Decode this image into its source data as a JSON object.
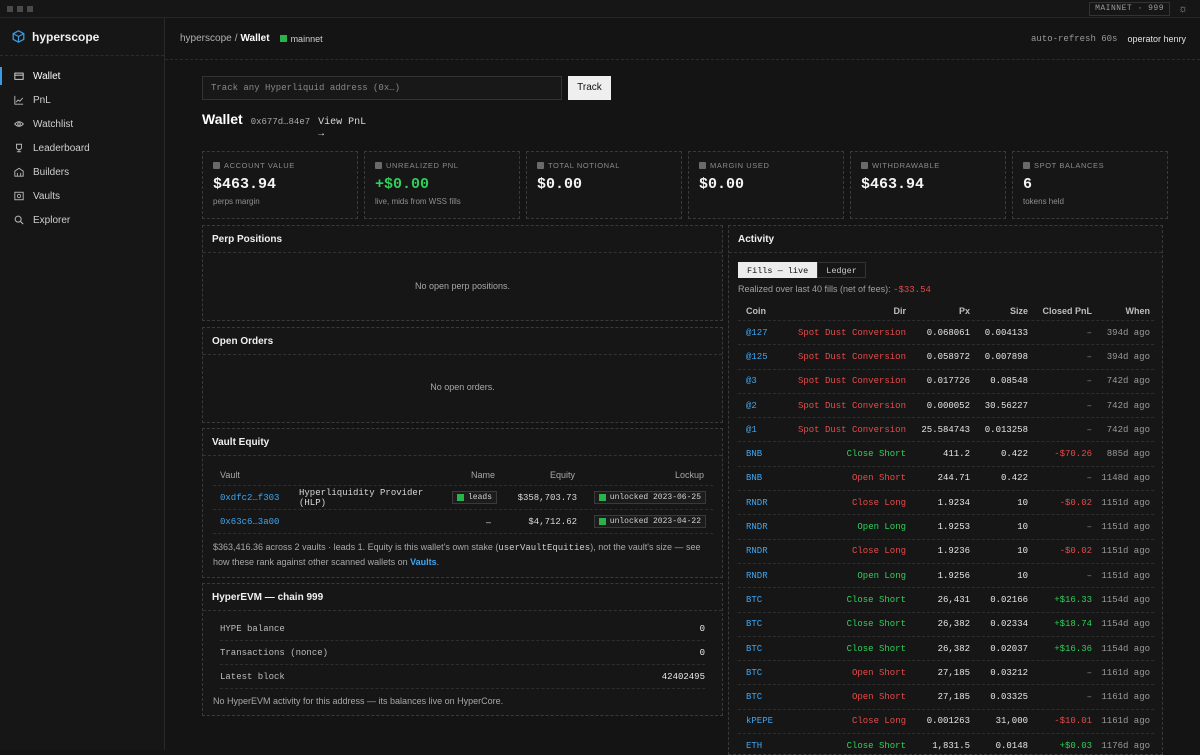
{
  "topbar": {
    "network_badge": "MAINNET · 999",
    "theme_icon": "sun-icon"
  },
  "sidebar": {
    "brand": "hyperscope",
    "items": [
      {
        "label": "Wallet",
        "icon": "wallet-icon",
        "active": true
      },
      {
        "label": "PnL",
        "icon": "chart-icon"
      },
      {
        "label": "Watchlist",
        "icon": "eye-icon"
      },
      {
        "label": "Leaderboard",
        "icon": "trophy-icon"
      },
      {
        "label": "Builders",
        "icon": "building-icon"
      },
      {
        "label": "Vaults",
        "icon": "vault-icon"
      },
      {
        "label": "Explorer",
        "icon": "search-icon"
      }
    ]
  },
  "header": {
    "crumb_root": "hyperscope",
    "crumb_sep": "/",
    "crumb_current": "Wallet",
    "network": "mainnet",
    "auto_refresh": "auto-refresh 60s",
    "operator": "operator henry"
  },
  "track": {
    "placeholder": "Track any Hyperliquid address (0x…)",
    "button": "Track"
  },
  "wallet": {
    "title": "Wallet",
    "address": "0x677d…84e7",
    "view_pnl": "View PnL →"
  },
  "stats": [
    {
      "label": "ACCOUNT VALUE",
      "value": "$463.94",
      "sub": "perps margin"
    },
    {
      "label": "UNREALIZED PNL",
      "value": "+$0.00",
      "sub": "live, mids from WSS fills",
      "color": "#2fcf5b"
    },
    {
      "label": "TOTAL NOTIONAL",
      "value": "$0.00",
      "sub": ""
    },
    {
      "label": "MARGIN USED",
      "value": "$0.00",
      "sub": ""
    },
    {
      "label": "WITHDRAWABLE",
      "value": "$463.94",
      "sub": ""
    },
    {
      "label": "SPOT BALANCES",
      "value": "6",
      "sub": "tokens held"
    }
  ],
  "perp": {
    "title": "Perp Positions",
    "empty": "No open perp positions."
  },
  "orders": {
    "title": "Open Orders",
    "empty": "No open orders."
  },
  "vault": {
    "title": "Vault Equity",
    "headers": [
      "Vault",
      "Name",
      "Equity",
      "Lockup"
    ],
    "rows": [
      {
        "vault": "0xdfc2…f303",
        "name": "Hyperliquidity Provider (HLP)",
        "tag": "leads",
        "equity": "$358,703.73",
        "lockup": "unlocked 2023-06-25"
      },
      {
        "vault": "0x63c6…3a00",
        "name": "–",
        "tag": "",
        "equity": "$4,712.62",
        "lockup": "unlocked 2023-04-22"
      }
    ],
    "note_a": "$363,416.36 across 2 vaults · leads 1. Equity is this wallet's own stake (",
    "note_code": "userVaultEquities",
    "note_b": "), not the vault's size — see how these rank against other scanned wallets on ",
    "note_link": "Vaults",
    "note_end": "."
  },
  "evm": {
    "title": "HyperEVM — chain 999",
    "rows": [
      {
        "label": "HYPE balance",
        "value": "0"
      },
      {
        "label": "Transactions (nonce)",
        "value": "0"
      },
      {
        "label": "Latest block",
        "value": "42402495"
      }
    ],
    "note": "No HyperEVM activity for this address — its balances live on HyperCore."
  },
  "activity": {
    "title": "Activity",
    "tabs": [
      "Fills — live",
      "Ledger"
    ],
    "realized_label": "Realized over last 40 fills (net of fees): ",
    "realized_value": "-$33.54",
    "headers": [
      "Coin",
      "Dir",
      "Px",
      "Size",
      "Closed PnL",
      "When"
    ],
    "rows": [
      {
        "coin": "@127",
        "dir": "Spot Dust Conversion",
        "px": "0.068061",
        "size": "0.004133",
        "pnl": "–",
        "when": "394d ago",
        "dc": "red",
        "pc": "muted"
      },
      {
        "coin": "@125",
        "dir": "Spot Dust Conversion",
        "px": "0.058972",
        "size": "0.007898",
        "pnl": "–",
        "when": "394d ago",
        "dc": "red",
        "pc": "muted"
      },
      {
        "coin": "@3",
        "dir": "Spot Dust Conversion",
        "px": "0.017726",
        "size": "0.08548",
        "pnl": "–",
        "when": "742d ago",
        "dc": "red",
        "pc": "muted"
      },
      {
        "coin": "@2",
        "dir": "Spot Dust Conversion",
        "px": "0.000052",
        "size": "30.56227",
        "pnl": "–",
        "when": "742d ago",
        "dc": "red",
        "pc": "muted"
      },
      {
        "coin": "@1",
        "dir": "Spot Dust Conversion",
        "px": "25.584743",
        "size": "0.013258",
        "pnl": "–",
        "when": "742d ago",
        "dc": "red",
        "pc": "muted"
      },
      {
        "coin": "BNB",
        "dir": "Close Short",
        "px": "411.2",
        "size": "0.422",
        "pnl": "-$70.26",
        "when": "885d ago",
        "dc": "grn",
        "pc": "red"
      },
      {
        "coin": "BNB",
        "dir": "Open Short",
        "px": "244.71",
        "size": "0.422",
        "pnl": "–",
        "when": "1148d ago",
        "dc": "red",
        "pc": "muted"
      },
      {
        "coin": "RNDR",
        "dir": "Close Long",
        "px": "1.9234",
        "size": "10",
        "pnl": "-$0.02",
        "when": "1151d ago",
        "dc": "red",
        "pc": "red"
      },
      {
        "coin": "RNDR",
        "dir": "Open Long",
        "px": "1.9253",
        "size": "10",
        "pnl": "–",
        "when": "1151d ago",
        "dc": "grn",
        "pc": "muted"
      },
      {
        "coin": "RNDR",
        "dir": "Close Long",
        "px": "1.9236",
        "size": "10",
        "pnl": "-$0.02",
        "when": "1151d ago",
        "dc": "red",
        "pc": "red"
      },
      {
        "coin": "RNDR",
        "dir": "Open Long",
        "px": "1.9256",
        "size": "10",
        "pnl": "–",
        "when": "1151d ago",
        "dc": "grn",
        "pc": "muted"
      },
      {
        "coin": "BTC",
        "dir": "Close Short",
        "px": "26,431",
        "size": "0.02166",
        "pnl": "+$16.33",
        "when": "1154d ago",
        "dc": "grn",
        "pc": "grn"
      },
      {
        "coin": "BTC",
        "dir": "Close Short",
        "px": "26,382",
        "size": "0.02334",
        "pnl": "+$18.74",
        "when": "1154d ago",
        "dc": "grn",
        "pc": "grn"
      },
      {
        "coin": "BTC",
        "dir": "Close Short",
        "px": "26,382",
        "size": "0.02037",
        "pnl": "+$16.36",
        "when": "1154d ago",
        "dc": "grn",
        "pc": "grn"
      },
      {
        "coin": "BTC",
        "dir": "Open Short",
        "px": "27,185",
        "size": "0.03212",
        "pnl": "–",
        "when": "1161d ago",
        "dc": "red",
        "pc": "muted"
      },
      {
        "coin": "BTC",
        "dir": "Open Short",
        "px": "27,185",
        "size": "0.03325",
        "pnl": "–",
        "when": "1161d ago",
        "dc": "red",
        "pc": "muted"
      },
      {
        "coin": "kPEPE",
        "dir": "Close Long",
        "px": "0.001263",
        "size": "31,000",
        "pnl": "-$10.01",
        "when": "1161d ago",
        "dc": "red",
        "pc": "red"
      },
      {
        "coin": "ETH",
        "dir": "Close Short",
        "px": "1,831.5",
        "size": "0.0148",
        "pnl": "+$0.03",
        "when": "1176d ago",
        "dc": "grn",
        "pc": "grn"
      }
    ]
  }
}
